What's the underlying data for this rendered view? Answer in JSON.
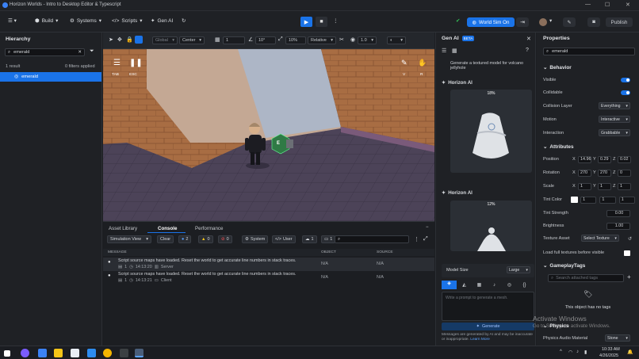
{
  "window": {
    "title": "Horizon Worlds - Intro to Desktop Editor & Typescript",
    "minimize": "—",
    "maximize": "☐",
    "close": "✕"
  },
  "menubar": {
    "build": "Build",
    "systems": "Systems",
    "scripts": "Scripts",
    "genai": "Gen AI",
    "world_sim": "World Sim On",
    "publish": "Publish"
  },
  "hierarchy": {
    "title": "Hierarchy",
    "search_value": "emerald",
    "result_count": "1 result",
    "filters": "0 filters applied",
    "items": [
      {
        "label": "emerald"
      }
    ]
  },
  "viewport_toolbar": {
    "space": "Global",
    "pivot": "Center",
    "snap_value": "1",
    "rotation_value": "10°",
    "scale_value": "10%",
    "mode": "Relative",
    "camera_speed": "1.0"
  },
  "scene_overlay": {
    "tab_label": "TAB",
    "esc_label": "ESC",
    "v_label": "V",
    "r_label": "R",
    "entity_badge": "E"
  },
  "console": {
    "tabs": [
      "Asset Library",
      "Console",
      "Performance"
    ],
    "active_tab": "Console",
    "view": "Simulation View",
    "clear": "Clear",
    "info_count": "2",
    "warn_count": "0",
    "err_count": "0",
    "system": "System",
    "user": "User",
    "cloud_count": "1",
    "local_count": "1",
    "columns": {
      "message": "MESSAGE",
      "object": "OBJECT",
      "source": "SOURCE"
    },
    "rows": [
      {
        "msg": "Script source maps have loaded. Reset the world to get accurate line numbers in stack traces.",
        "count": "1",
        "time": "14:13:20",
        "origin": "Server",
        "object": "N/A",
        "source": "N/A"
      },
      {
        "msg": "Script source maps have loaded. Reset the world to get accurate line numbers in stack traces.",
        "count": "1",
        "time": "14:13:21",
        "origin": "Client",
        "object": "N/A",
        "source": "N/A"
      }
    ]
  },
  "genai": {
    "title": "Gen AI",
    "beta": "BETA",
    "prompt_text": "Generate a textured model for volcano jellyhole",
    "section1": "Horizon AI",
    "progress1": "18%",
    "section2": "Horizon AI",
    "progress2": "12%",
    "model_size_label": "Model Size",
    "model_size": "Large",
    "placeholder": "Write a prompt to generate a mesh.",
    "generate": "Generate",
    "disclaimer": "Messages are generated by AI and may be inaccurate or inappropriate.",
    "learn_more": "Learn More"
  },
  "properties": {
    "title": "Properties",
    "search_value": "emerald",
    "behavior": {
      "title": "Behavior",
      "visible": "Visible",
      "collidable": "Collidable",
      "collision_layer": "Collision Layer",
      "collision_layer_value": "Everything",
      "motion": "Motion",
      "motion_value": "Interactive",
      "interaction": "Interaction",
      "interaction_value": "Grabbable"
    },
    "attributes": {
      "title": "Attributes",
      "position": "Position",
      "px": "14.96",
      "py": "0.29",
      "pz": "0.02",
      "rotation": "Rotation",
      "rx": "270",
      "ry": "270",
      "rz": "0",
      "scale": "Scale",
      "sx": "1",
      "sy": "1",
      "sz": "1",
      "tint_color": "Tint Color",
      "tint_a": "1",
      "tint_b": "1",
      "tint_c": "1",
      "tint_strength": "Tint Strength",
      "tint_strength_value": "0.00",
      "brightness": "Brightness",
      "brightness_value": "1.00",
      "texture_asset": "Texture Asset",
      "texture_value": "Select Texture",
      "load_full": "Load full textures before visible"
    },
    "gameplay_tags": {
      "title": "GameplayTags",
      "placeholder": "Search attached tags",
      "empty": "This object has no tags"
    },
    "physics": {
      "title": "Physics",
      "audio_label": "Physics Audio Material",
      "audio_value": "Stone"
    }
  },
  "watermark": {
    "line1": "Activate Windows",
    "line2": "Go to Settings to activate Windows."
  },
  "taskbar": {
    "time": "10:33 AM",
    "date": "4/26/2025"
  },
  "colors": {
    "accent": "#1a73e8",
    "panel": "#1f2125",
    "scene_wall": "#c4a894",
    "scene_floor": "#4c4358"
  }
}
